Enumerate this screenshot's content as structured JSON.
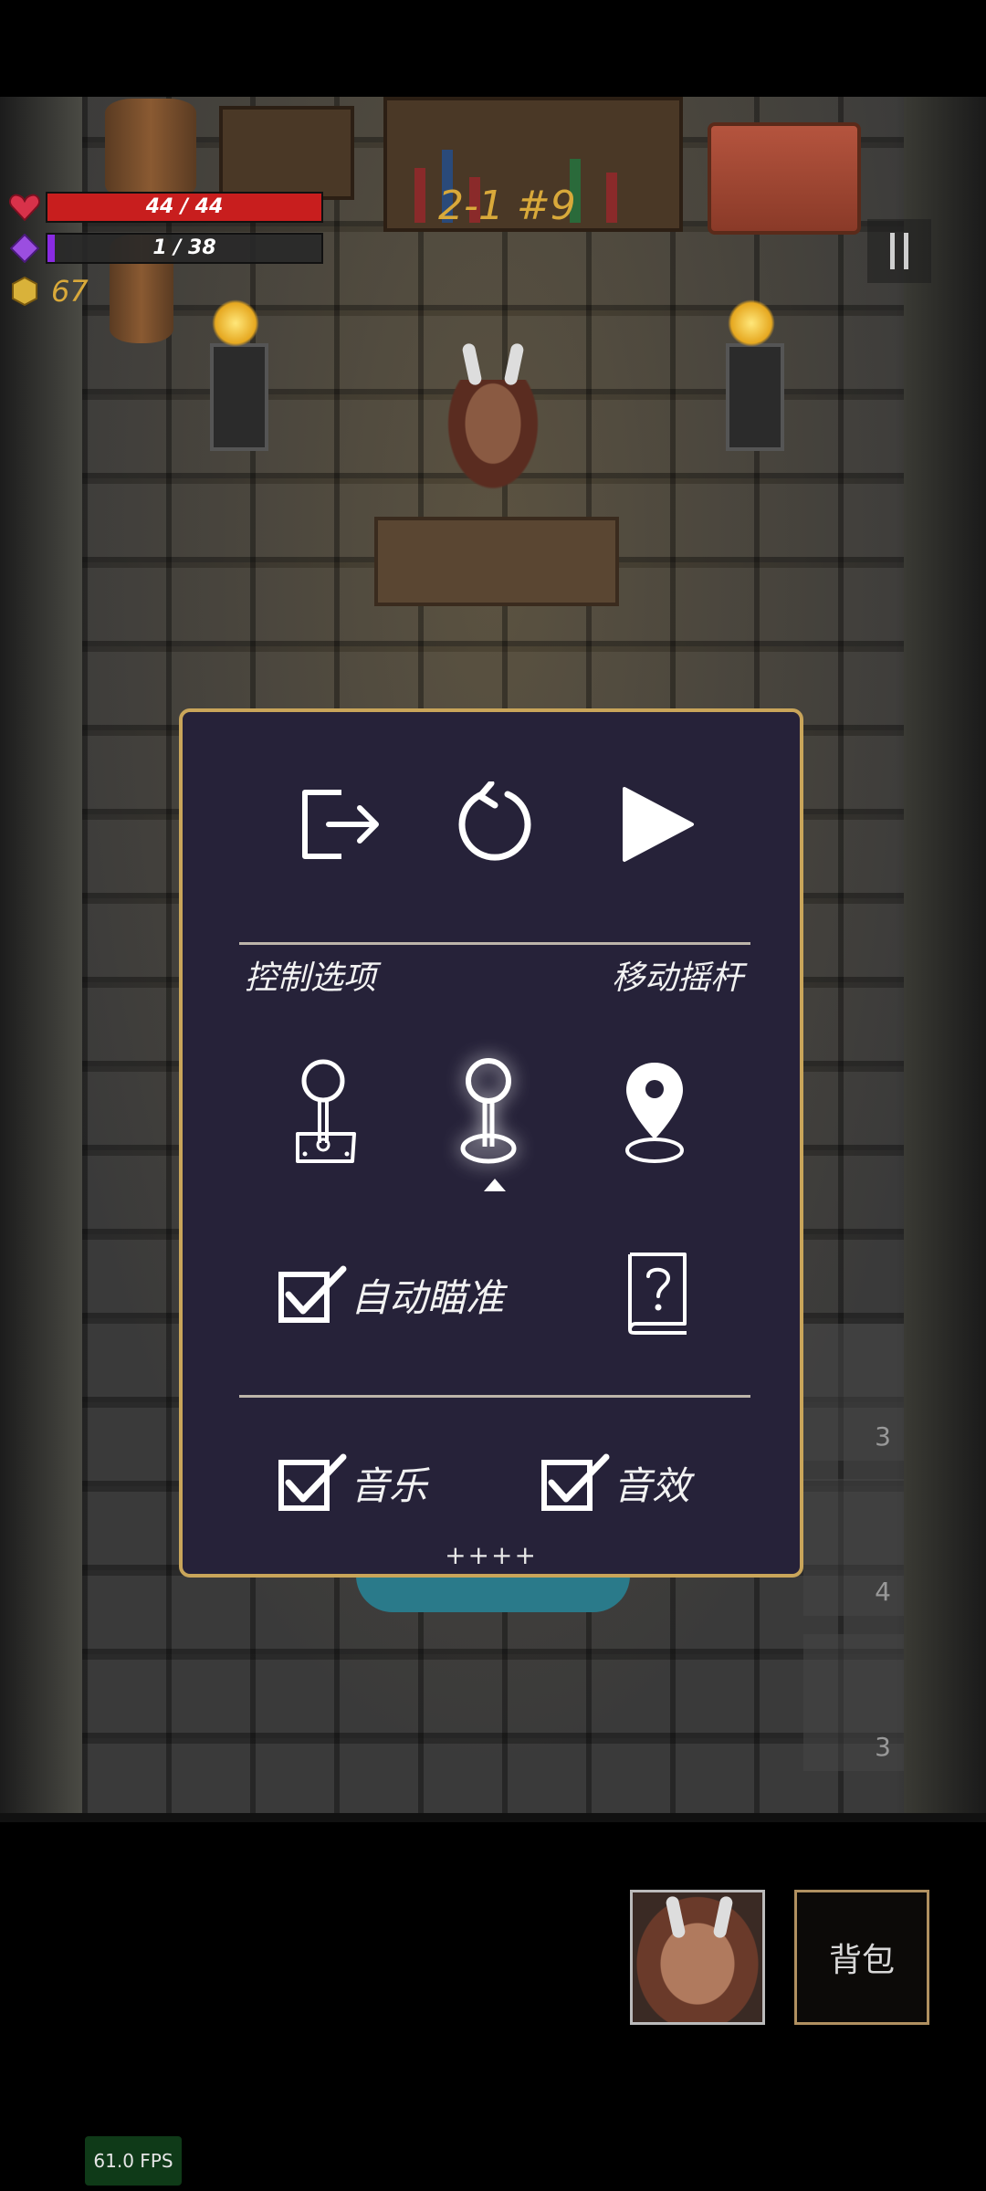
{
  "hud": {
    "hp": {
      "current": 44,
      "max": 44,
      "text": "44 / 44",
      "color": "#c81e1e"
    },
    "energy": {
      "current": 1,
      "max": 38,
      "text": "1 / 38",
      "color": "#8a2be2"
    },
    "coins": "67",
    "level": "2-1 #9"
  },
  "menu": {
    "top_actions": [
      {
        "name": "exit",
        "icon": "exit-icon"
      },
      {
        "name": "restart",
        "icon": "restart-icon"
      },
      {
        "name": "resume",
        "icon": "play-icon"
      }
    ],
    "control_options_label": "控制选项",
    "joystick_mode_label": "移动摇杆",
    "joystick_modes": [
      {
        "name": "fixed",
        "icon": "joystick-fixed-icon",
        "selected": false
      },
      {
        "name": "floating",
        "icon": "joystick-floating-icon",
        "selected": true
      },
      {
        "name": "location",
        "icon": "location-pin-icon",
        "selected": false
      }
    ],
    "auto_aim": {
      "label": "自动瞄准",
      "checked": true
    },
    "help_icon": "help-book-icon",
    "music": {
      "label": "音乐",
      "checked": true
    },
    "sfx": {
      "label": "音效",
      "checked": true
    },
    "credits": "++++"
  },
  "skill_slots": [
    {
      "count": "3"
    },
    {
      "count": "4"
    },
    {
      "count": "3"
    }
  ],
  "bottom": {
    "bag_label": "背包",
    "fps": "61.0 FPS"
  },
  "colors": {
    "panel_bg": "#262239",
    "panel_border": "#c9a55a",
    "gold_text": "#d9a93a"
  }
}
